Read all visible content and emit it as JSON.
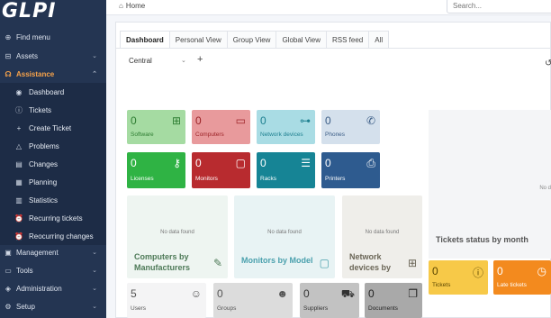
{
  "logo": {
    "text": "GLPI"
  },
  "sidebar": {
    "items": [
      {
        "label": "Find menu",
        "icon": "search-icon",
        "glyph": "⊕",
        "chevron": ""
      },
      {
        "label": "Assets",
        "icon": "box-icon",
        "glyph": "⊟",
        "chevron": "⌄"
      },
      {
        "label": "Assistance",
        "icon": "headset-icon",
        "glyph": "☊",
        "chevron": "⌃"
      }
    ],
    "sub_items": [
      {
        "label": "Dashboard",
        "icon": "dashboard-icon",
        "glyph": "◉"
      },
      {
        "label": "Tickets",
        "icon": "alert-circle-icon",
        "glyph": "ⓘ"
      },
      {
        "label": "Create Ticket",
        "icon": "plus-icon",
        "glyph": "+"
      },
      {
        "label": "Problems",
        "icon": "warning-icon",
        "glyph": "△"
      },
      {
        "label": "Changes",
        "icon": "clipboard-icon",
        "glyph": "▤"
      },
      {
        "label": "Planning",
        "icon": "calendar-icon",
        "glyph": "▦"
      },
      {
        "label": "Statistics",
        "icon": "chart-icon",
        "glyph": "▥"
      },
      {
        "label": "Recurring tickets",
        "icon": "alarm-icon",
        "glyph": "⏰"
      },
      {
        "label": "Reocurring changes",
        "icon": "alarm-icon",
        "glyph": "⏰"
      }
    ],
    "bottom_items": [
      {
        "label": "Management",
        "icon": "wallet-icon",
        "glyph": "▣",
        "chevron": "⌄"
      },
      {
        "label": "Tools",
        "icon": "briefcase-icon",
        "glyph": "▭",
        "chevron": "⌄"
      },
      {
        "label": "Administration",
        "icon": "shield-icon",
        "glyph": "◈",
        "chevron": "⌄"
      },
      {
        "label": "Setup",
        "icon": "gear-icon",
        "glyph": "⚙",
        "chevron": "⌄"
      }
    ]
  },
  "topbar": {
    "breadcrumb": "Home",
    "home_glyph": "⌂",
    "search_placeholder": "Search..."
  },
  "tabs": [
    "Dashboard",
    "Personal View",
    "Group View",
    "Global View",
    "RSS feed",
    "All"
  ],
  "dashboard_selector": {
    "value": "Central",
    "caret": "⌄",
    "add_glyph": "+",
    "history_glyph": "↺"
  },
  "cards": [
    {
      "value": "0",
      "label": "Software",
      "icon": "apps-icon",
      "glyph": "⊞",
      "bg": "#a5dba2",
      "fg": "#2e7d32"
    },
    {
      "value": "0",
      "label": "Computers",
      "icon": "laptop-icon",
      "glyph": "▭",
      "bg": "#e89a9c",
      "fg": "#9b2226"
    },
    {
      "value": "0",
      "label": "Network devices",
      "icon": "network-icon",
      "glyph": "⊶",
      "bg": "#a9dce4",
      "fg": "#1d7f8f"
    },
    {
      "value": "0",
      "label": "Phones",
      "icon": "phone-icon",
      "glyph": "✆",
      "bg": "#d4e0ec",
      "fg": "#3b5d86"
    },
    {
      "value": "0",
      "label": "Licenses",
      "icon": "key-icon",
      "glyph": "⚷",
      "bg": "#2fb344",
      "fg": "#ffffff"
    },
    {
      "value": "0",
      "label": "Monitors",
      "icon": "monitor-icon",
      "glyph": "▢",
      "bg": "#b82b2f",
      "fg": "#ffffff"
    },
    {
      "value": "0",
      "label": "Racks",
      "icon": "server-icon",
      "glyph": "☰",
      "bg": "#168495",
      "fg": "#ffffff"
    },
    {
      "value": "0",
      "label": "Printers",
      "icon": "printer-icon",
      "glyph": "⎙",
      "bg": "#2e5b8f",
      "fg": "#ffffff"
    }
  ],
  "big_cards": [
    {
      "title": "Computers by Manufacturers",
      "nodata": "No data found",
      "icon": "edit-icon",
      "glyph": "✎",
      "bg": "#eef5f1",
      "fg": "#4e7a58"
    },
    {
      "title": "Monitors by Model",
      "nodata": "No data found",
      "icon": "monitor-icon",
      "glyph": "▢",
      "bg": "#e8f3f4",
      "fg": "#4aa0ad"
    },
    {
      "title": "Network devices by",
      "nodata": "No data found",
      "icon": "hierarchy-icon",
      "glyph": "⊞",
      "bg": "#efeeea",
      "fg": "#6b6657"
    }
  ],
  "bottom_cards": [
    {
      "value": "5",
      "label": "Users",
      "icon": "user-icon",
      "glyph": "☺",
      "bg": "#f4f4f5",
      "fg": "#555555"
    },
    {
      "value": "0",
      "label": "Groups",
      "icon": "users-icon",
      "glyph": "☻",
      "bg": "#dcdcdc",
      "fg": "#555555"
    },
    {
      "value": "0",
      "label": "Suppliers",
      "icon": "truck-icon",
      "glyph": "⛟",
      "bg": "#c2c2c2",
      "fg": "#333333"
    },
    {
      "value": "0",
      "label": "Documents",
      "icon": "files-icon",
      "glyph": "❐",
      "bg": "#a9a9a9",
      "fg": "#222222"
    }
  ],
  "status_cards": [
    {
      "value": "0",
      "label": "Tickets",
      "icon": "alert-icon",
      "glyph": "ⓘ",
      "bg": "#f7c948",
      "fg": "#5a4500"
    },
    {
      "value": "0",
      "label": "Late tickets",
      "icon": "clock-icon",
      "glyph": "◷",
      "bg": "#f38a1e",
      "fg": "#ffffff"
    }
  ],
  "tickets_status": {
    "title": "Tickets status by month",
    "nodata": "No d"
  }
}
